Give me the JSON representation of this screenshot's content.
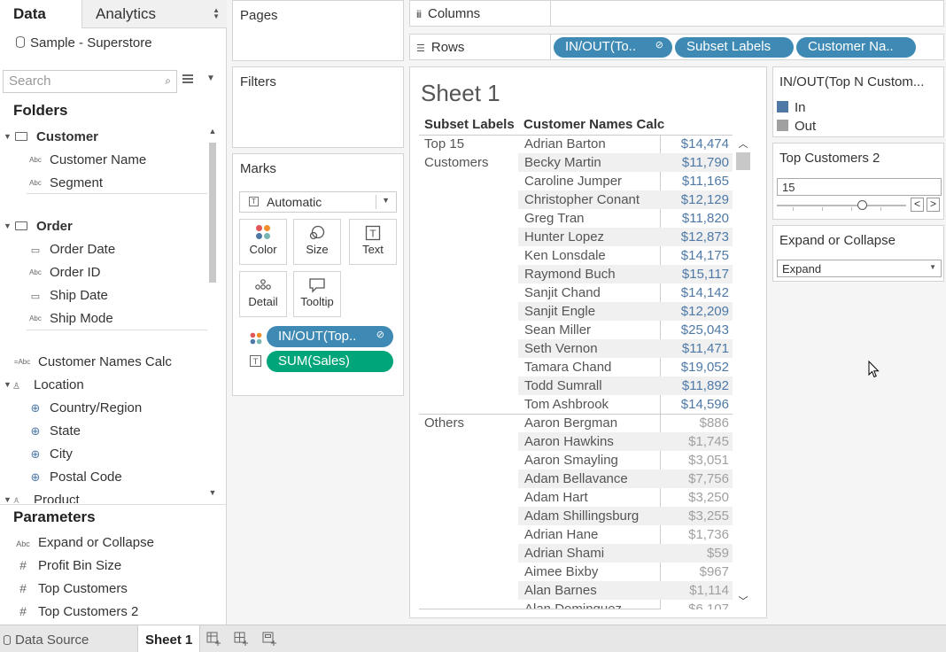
{
  "left_pane": {
    "tabs": {
      "data": "Data",
      "analytics": "Analytics"
    },
    "datasource": "Sample - Superstore",
    "search_placeholder": "Search",
    "folders_heading": "Folders",
    "parameters_heading": "Parameters",
    "fields": [
      {
        "label": "Customer",
        "kind": "folder",
        "bold": true
      },
      {
        "label": "Customer Name",
        "kind": "Abc"
      },
      {
        "label": "Segment",
        "kind": "Abc"
      },
      {
        "label": "Order",
        "kind": "folder",
        "bold": true
      },
      {
        "label": "Order Date",
        "kind": "date"
      },
      {
        "label": "Order ID",
        "kind": "Abc"
      },
      {
        "label": "Ship Date",
        "kind": "date"
      },
      {
        "label": "Ship Mode",
        "kind": "Abc"
      },
      {
        "label": "Customer Names Calc",
        "kind": "=Abc"
      },
      {
        "label": "Location",
        "kind": "hierarchy"
      },
      {
        "label": "Country/Region",
        "kind": "geo"
      },
      {
        "label": "State",
        "kind": "geo"
      },
      {
        "label": "City",
        "kind": "geo"
      },
      {
        "label": "Postal Code",
        "kind": "geo"
      },
      {
        "label": "Product",
        "kind": "hierarchy"
      }
    ],
    "parameters": [
      {
        "label": "Expand or Collapse",
        "kind": "Abc"
      },
      {
        "label": "Profit Bin Size",
        "kind": "#"
      },
      {
        "label": "Top Customers",
        "kind": "#"
      },
      {
        "label": "Top Customers 2",
        "kind": "#"
      }
    ]
  },
  "cards": {
    "pages": "Pages",
    "filters": "Filters",
    "marks": {
      "title": "Marks",
      "mark_type": "Automatic",
      "buttons": [
        "Color",
        "Size",
        "Text",
        "Detail",
        "Tooltip"
      ],
      "pills": [
        "IN/OUT(Top..",
        "SUM(Sales)"
      ]
    }
  },
  "shelves": {
    "columns_label": "Columns",
    "rows_label": "Rows",
    "rows_pills": [
      "IN/OUT(To..",
      "Subset Labels",
      "Customer Na.."
    ]
  },
  "view": {
    "title": "Sheet 1",
    "col_headers": {
      "subset": "Subset Labels",
      "name": "Customer Names Calc"
    },
    "groups": [
      {
        "label_line1": "Top 15",
        "label_line2": "Customers",
        "color": "#4e79a7",
        "rows": [
          {
            "name": "Adrian Barton",
            "value": "$14,474"
          },
          {
            "name": "Becky Martin",
            "value": "$11,790"
          },
          {
            "name": "Caroline Jumper",
            "value": "$11,165"
          },
          {
            "name": "Christopher Conant",
            "value": "$12,129"
          },
          {
            "name": "Greg Tran",
            "value": "$11,820"
          },
          {
            "name": "Hunter Lopez",
            "value": "$12,873"
          },
          {
            "name": "Ken Lonsdale",
            "value": "$14,175"
          },
          {
            "name": "Raymond Buch",
            "value": "$15,117"
          },
          {
            "name": "Sanjit Chand",
            "value": "$14,142"
          },
          {
            "name": "Sanjit Engle",
            "value": "$12,209"
          },
          {
            "name": "Sean Miller",
            "value": "$25,043"
          },
          {
            "name": "Seth Vernon",
            "value": "$11,471"
          },
          {
            "name": "Tamara Chand",
            "value": "$19,052"
          },
          {
            "name": "Todd Sumrall",
            "value": "$11,892"
          },
          {
            "name": "Tom Ashbrook",
            "value": "$14,596"
          }
        ]
      },
      {
        "label_line1": "Others",
        "label_line2": "",
        "color": "#a0a0a0",
        "rows": [
          {
            "name": "Aaron Bergman",
            "value": "$886"
          },
          {
            "name": "Aaron Hawkins",
            "value": "$1,745"
          },
          {
            "name": "Aaron Smayling",
            "value": "$3,051"
          },
          {
            "name": "Adam Bellavance",
            "value": "$7,756"
          },
          {
            "name": "Adam Hart",
            "value": "$3,250"
          },
          {
            "name": "Adam Shillingsburg",
            "value": "$3,255"
          },
          {
            "name": "Adrian Hane",
            "value": "$1,736"
          },
          {
            "name": "Adrian Shami",
            "value": "$59"
          },
          {
            "name": "Aimee Bixby",
            "value": "$967"
          },
          {
            "name": "Alan Barnes",
            "value": "$1,114"
          },
          {
            "name": "Alan Dominguez",
            "value": "$6,107"
          }
        ]
      }
    ]
  },
  "legend": {
    "title": "IN/OUT(Top N Custom...",
    "items": [
      {
        "label": "In",
        "color": "#4e79a7"
      },
      {
        "label": "Out",
        "color": "#a0a0a0"
      }
    ]
  },
  "param_top2": {
    "title": "Top Customers 2",
    "value": "15",
    "prev": "<",
    "next": ">"
  },
  "param_expand": {
    "title": "Expand or Collapse",
    "value": "Expand"
  },
  "bottom_bar": {
    "data_source": "Data Source",
    "sheet": "Sheet 1"
  }
}
